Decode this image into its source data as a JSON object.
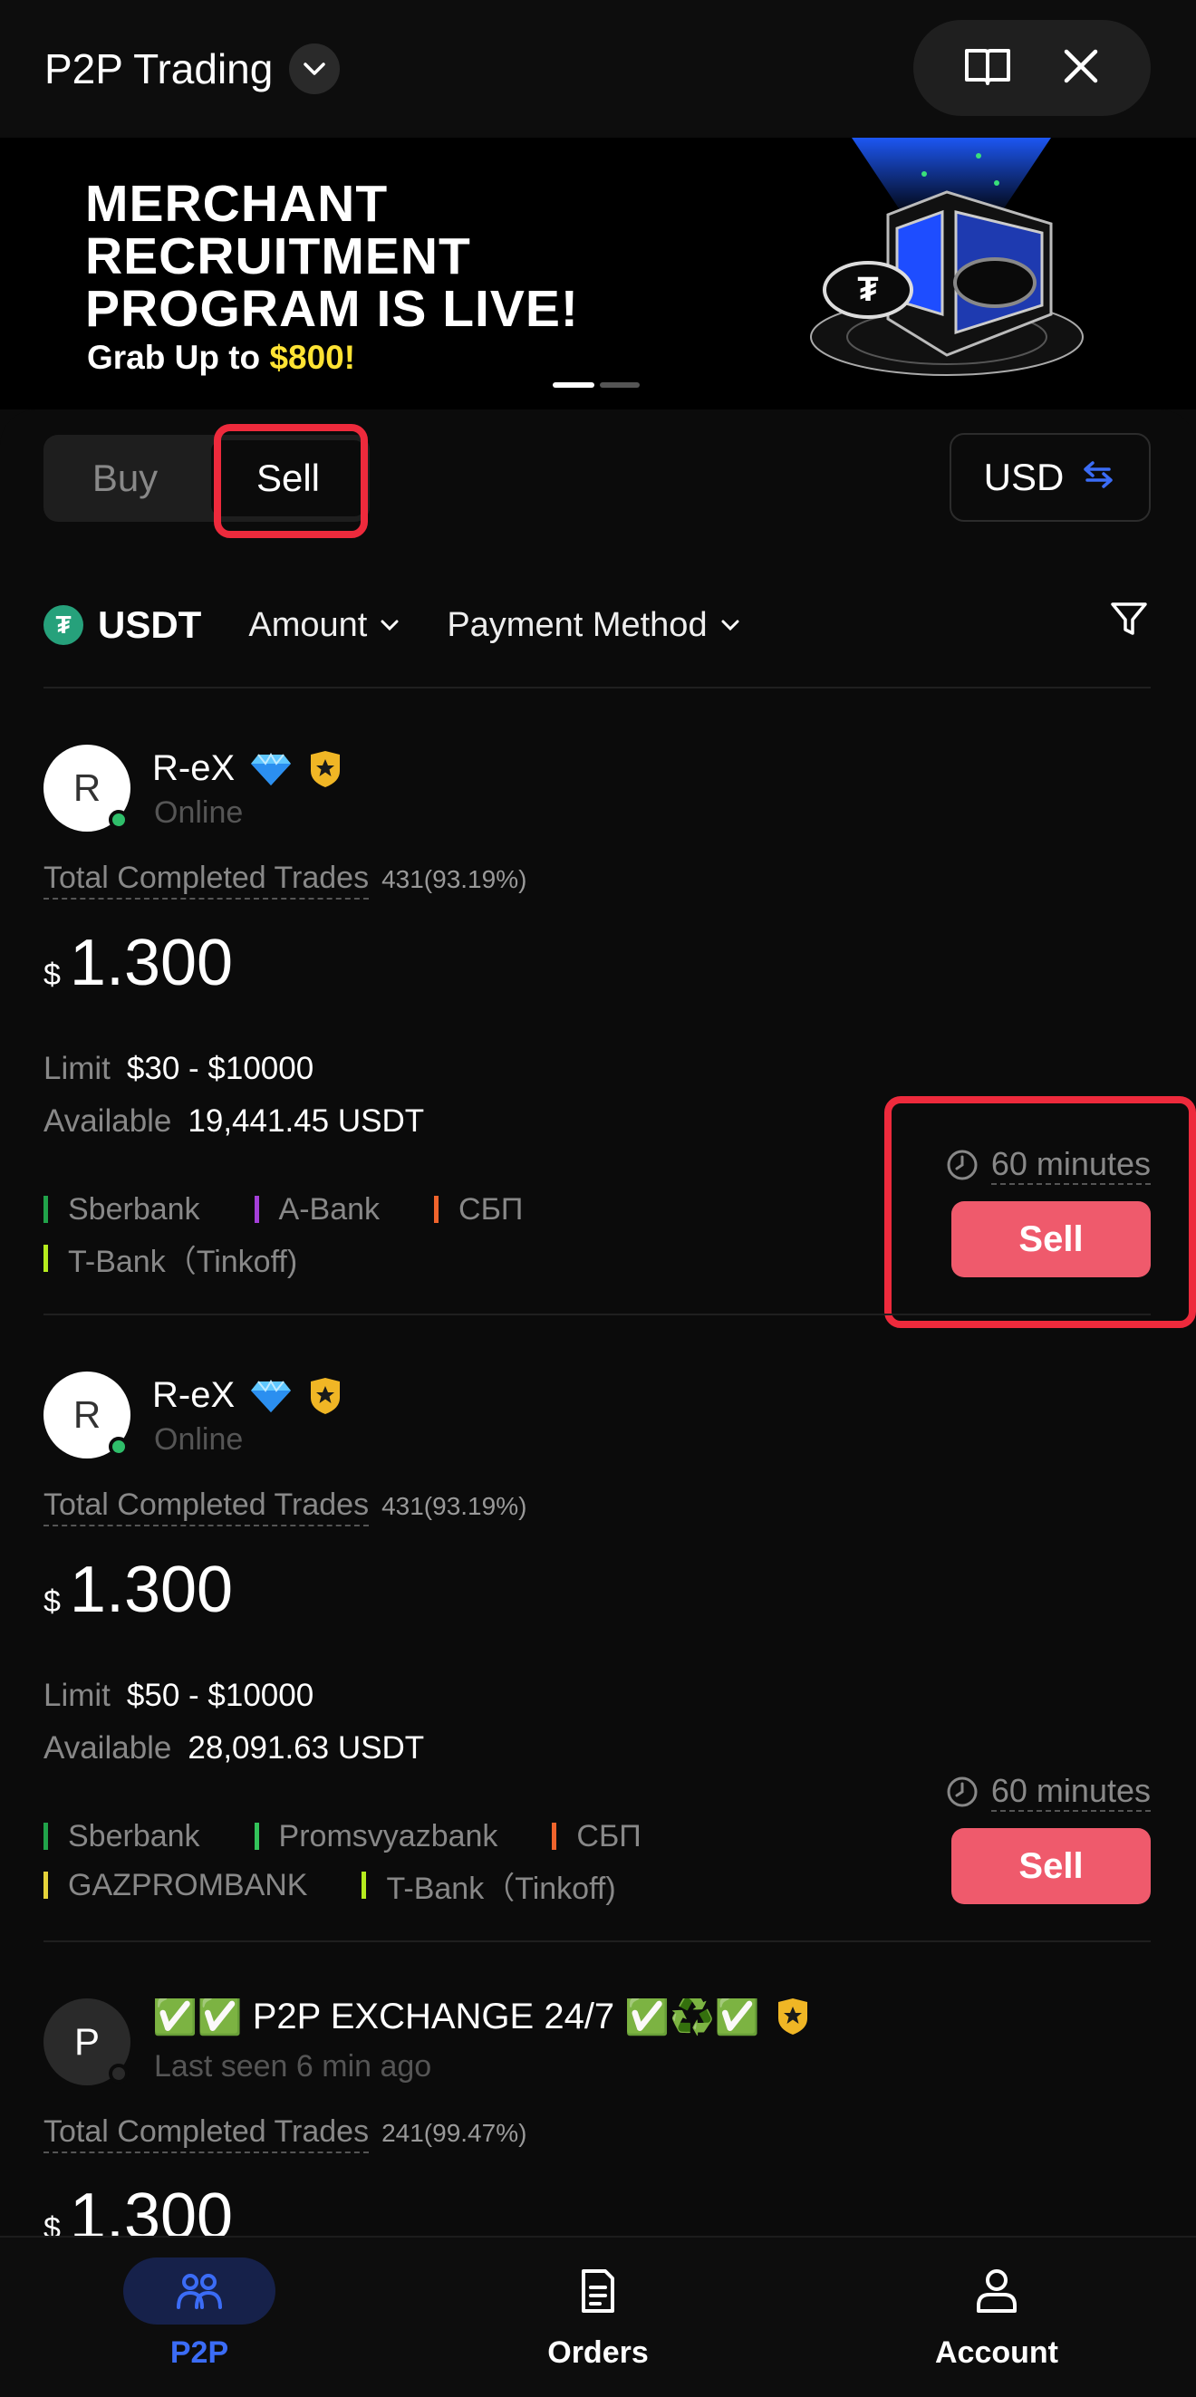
{
  "header": {
    "title": "P2P Trading"
  },
  "banner": {
    "line1": "MERCHANT",
    "line2": "RECRUITMENT",
    "line3": "PROGRAM IS LIVE!",
    "sub_prefix": "Grab Up to ",
    "sub_amount": "$800!"
  },
  "tabs": {
    "buy": "Buy",
    "sell": "Sell",
    "selected": "Sell"
  },
  "currency": "USD",
  "filters": {
    "coin": "USDT",
    "coin_symbol": "₮",
    "amount": "Amount",
    "payment": "Payment Method"
  },
  "listings": [
    {
      "initial": "R",
      "name": "R-eX",
      "status": "Online",
      "trades_label": "Total Completed Trades",
      "trades": "431(93.19%)",
      "price_symbol": "$",
      "price": "1.300",
      "limit_label": "Limit",
      "limit": "$30 - $10000",
      "available_label": "Available",
      "available": "19,441.45 USDT",
      "time": "60 minutes",
      "button": "Sell",
      "payments": [
        {
          "name": "Sberbank",
          "color": "#21a34a"
        },
        {
          "name": "A-Bank",
          "color": "#a43fd8"
        },
        {
          "name": "СБП",
          "color": "#f0642c"
        },
        {
          "name": "T-Bank（Tinkoff)",
          "color": "#b6ec1e"
        }
      ]
    },
    {
      "initial": "R",
      "name": "R-eX",
      "status": "Online",
      "trades_label": "Total Completed Trades",
      "trades": "431(93.19%)",
      "price_symbol": "$",
      "price": "1.300",
      "limit_label": "Limit",
      "limit": "$50 - $10000",
      "available_label": "Available",
      "available": "28,091.63 USDT",
      "time": "60 minutes",
      "button": "Sell",
      "payments": [
        {
          "name": "Sberbank",
          "color": "#21a34a"
        },
        {
          "name": "Promsvyazbank",
          "color": "#33c35a"
        },
        {
          "name": "СБП",
          "color": "#f0642c"
        },
        {
          "name": "GAZPROMBANK",
          "color": "#e6d33a"
        },
        {
          "name": "T-Bank（Tinkoff)",
          "color": "#b6ec1e"
        }
      ]
    },
    {
      "initial": "P",
      "name": "✅✅ P2P EXCHANGE 24/7 ✅♻️✅",
      "status": "Last seen 6 min ago",
      "trades_label": "Total Completed Trades",
      "trades": "241(99.47%)",
      "price_symbol": "$",
      "price": "1.300"
    }
  ],
  "nav": {
    "p2p": "P2P",
    "orders": "Orders",
    "account": "Account"
  },
  "colors": {
    "accent": "#3b6cf6",
    "sell": "#ef5a6c",
    "highlight": "#ee2a3c"
  },
  "icons": [
    "chevron-down-icon",
    "book-icon",
    "close-icon",
    "swap-icon",
    "filter-icon",
    "diamond-icon",
    "verified-badge-icon",
    "clock-icon",
    "p2p-people-icon",
    "orders-document-icon",
    "account-person-icon"
  ]
}
